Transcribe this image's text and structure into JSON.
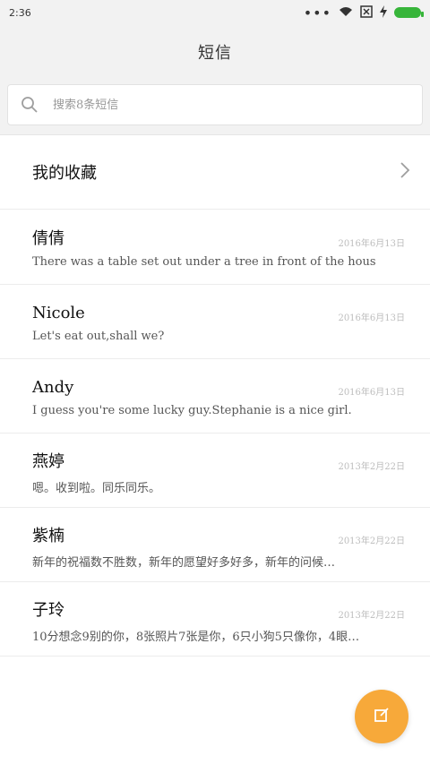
{
  "status_bar": {
    "time": "2:36"
  },
  "header": {
    "title": "短信"
  },
  "search": {
    "placeholder": "搜索8条短信"
  },
  "favorites": {
    "label": "我的收藏"
  },
  "messages": [
    {
      "name": "倩倩",
      "date": "2016年6月13日",
      "preview": "There was a table set out under a tree in front of the hous"
    },
    {
      "name": "Nicole",
      "date": "2016年6月13日",
      "preview": "Let's eat out,shall we?"
    },
    {
      "name": "Andy",
      "date": "2016年6月13日",
      "preview": "I guess you're some lucky guy.Stephanie is a nice girl."
    },
    {
      "name": "燕婷",
      "date": "2013年2月22日",
      "preview": "嗯。收到啦。同乐同乐。"
    },
    {
      "name": "紫楠",
      "date": "2013年2月22日",
      "preview": "新年的祝福数不胜数，新年的愿望好多好多，新年的问候…"
    },
    {
      "name": "子玲",
      "date": "2013年2月22日",
      "preview": "10分想念9别的你，8张照片7张是你，6只小狗5只像你，4眼…"
    }
  ],
  "colors": {
    "accent": "#f7a93a",
    "battery": "#37b53a",
    "background": "#f2f2f2"
  },
  "icons": {
    "search": "search-icon",
    "chevron": "chevron-right-icon",
    "compose": "compose-icon",
    "wifi": "wifi-icon",
    "signal": "no-signal-icon",
    "battery": "battery-icon"
  }
}
